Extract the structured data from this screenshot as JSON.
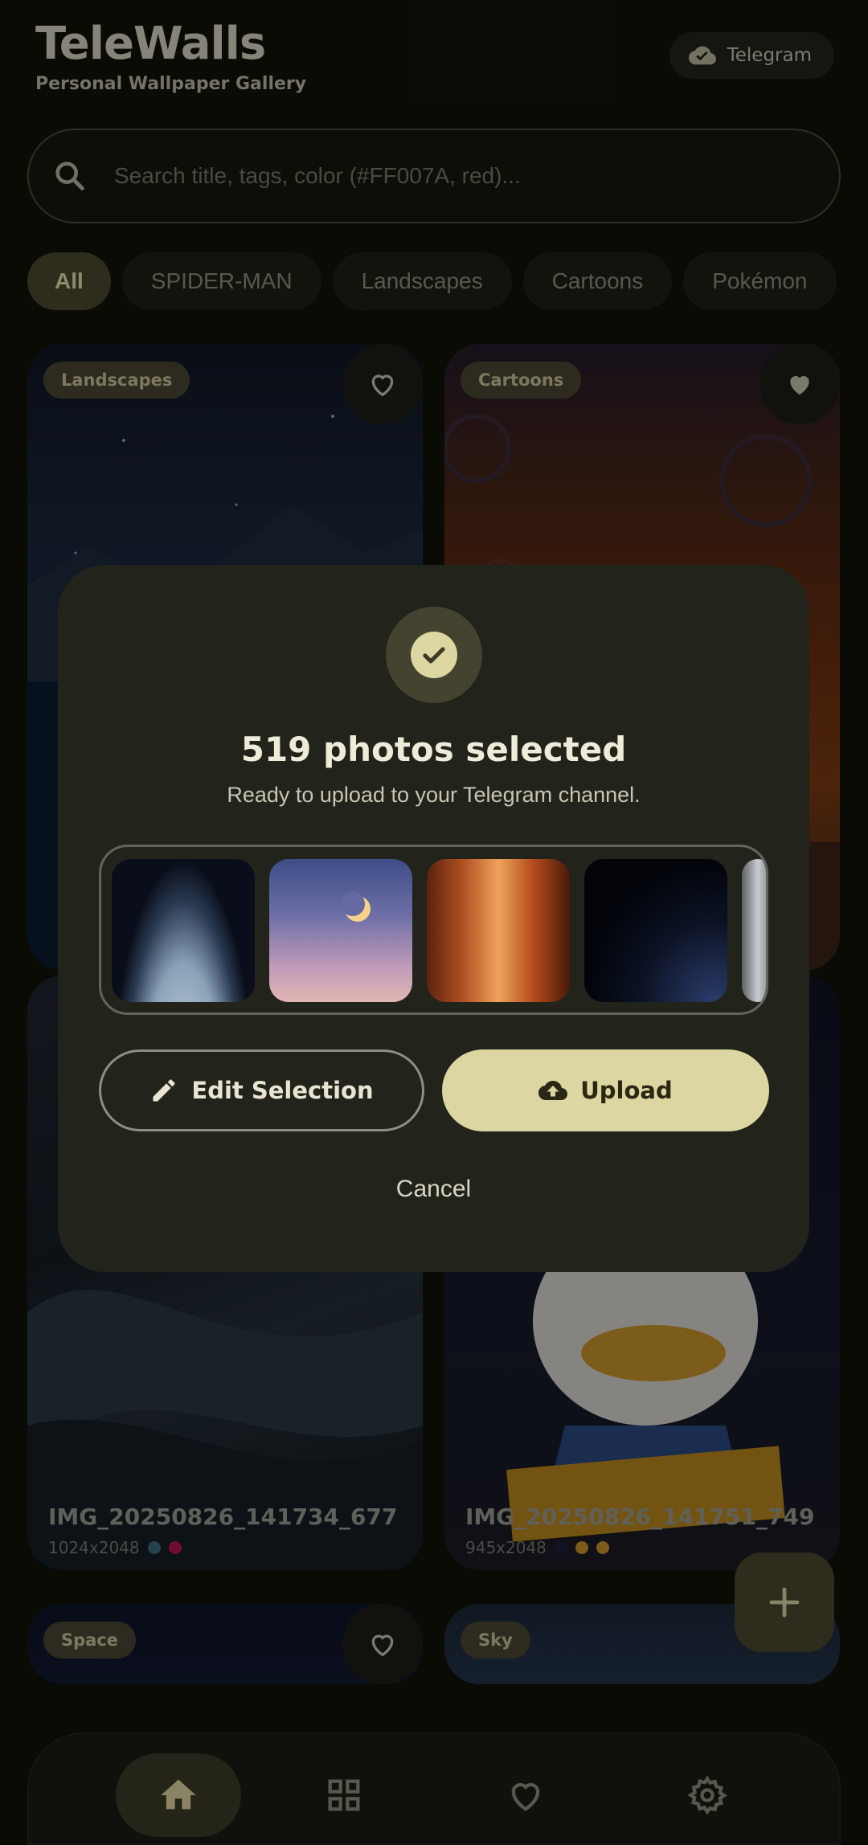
{
  "header": {
    "title": "TeleWalls",
    "subtitle": "Personal Wallpaper Gallery",
    "telegram_chip": "Telegram"
  },
  "search": {
    "placeholder": "Search title, tags, color (#FF007A, red)..."
  },
  "filters": [
    "All",
    "SPIDER-MAN",
    "Landscapes",
    "Cartoons",
    "Pokémon"
  ],
  "cards": [
    {
      "tag": "Landscapes",
      "name": "",
      "size": "",
      "favorited": false
    },
    {
      "tag": "Cartoons",
      "name": "",
      "size": "",
      "favorited": true
    },
    {
      "tag": "",
      "name": "IMG_20250826_141734_677",
      "size": "1024x2048",
      "colors": [
        "#3d6a7a",
        "#b0184e"
      ]
    },
    {
      "tag": "",
      "name": "IMG_20250826_141751_749",
      "size": "945x2048",
      "colors": [
        "#1a1f3a",
        "#c8952a",
        "#c8952a"
      ]
    },
    {
      "tag": "Space",
      "favorited": false
    },
    {
      "tag": "Sky",
      "favorited": false
    }
  ],
  "dialog": {
    "title": "519 photos selected",
    "subtitle": "Ready to upload to your Telegram channel.",
    "edit_label": "Edit Selection",
    "upload_label": "Upload",
    "cancel_label": "Cancel"
  },
  "nav": [
    "home-icon",
    "grid-icon",
    "heart-icon",
    "gear-icon"
  ],
  "colors": {
    "accent": "#dcd6a2",
    "background": "#121309",
    "dialog": "#22231a"
  }
}
